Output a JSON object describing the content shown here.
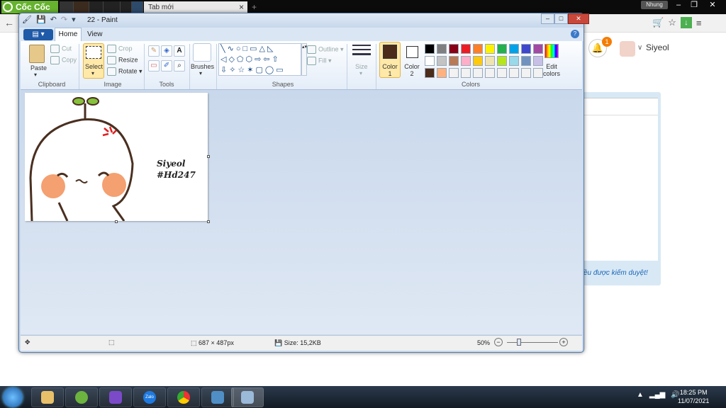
{
  "browser": {
    "logo_text": "Cốc Cốc",
    "active_tab_title": "Tab mới",
    "profile_label": "Nhung",
    "user_name": "Siyeol",
    "notification_count": "1",
    "card_text": "ều được kiểm duyệt!"
  },
  "paint": {
    "window_title": "22 - Paint",
    "tabs": [
      "Home",
      "View"
    ],
    "clipboard": {
      "paste": "Paste",
      "cut": "Cut",
      "copy": "Copy",
      "label": "Clipboard"
    },
    "image": {
      "select": "Select",
      "crop": "Crop",
      "resize": "Resize",
      "rotate": "Rotate",
      "label": "Image"
    },
    "tools": {
      "label": "Tools"
    },
    "brushes": "Brushes",
    "shapes": {
      "outline": "Outline",
      "fill": "Fill",
      "label": "Shapes"
    },
    "size": "Size",
    "color1": "Color 1",
    "color2": "Color 2",
    "colors_label": "Colors",
    "edit_colors": "Edit colors",
    "palette": [
      [
        "#000000",
        "#7f7f7f",
        "#880015",
        "#ed1c24",
        "#ff7f27",
        "#fff200",
        "#22b14c",
        "#00a2e8",
        "#3f48cc",
        "#a349a4"
      ],
      [
        "#ffffff",
        "#c3c3c3",
        "#b97a57",
        "#ffaec9",
        "#ffc90e",
        "#efe4b0",
        "#b5e61d",
        "#99d9ea",
        "#7092be",
        "#c8bfe7"
      ],
      [
        "#4b2b1a",
        "#ffb27f",
        "#f2f2f2",
        "#f2f2f2",
        "#f2f2f2",
        "#f2f2f2",
        "#f2f2f2",
        "#f2f2f2",
        "#f2f2f2",
        "#f2f2f2"
      ]
    ],
    "canvas_text_line1": "Siyeol",
    "canvas_text_line2": "#Hd247",
    "status": {
      "dimensions": "687 × 487px",
      "size": "Size: 15,2KB",
      "zoom": "50%"
    }
  },
  "taskbar": {
    "time": "18:25 PM",
    "date": "11/07/2021",
    "zalo_label": "Zalo"
  }
}
